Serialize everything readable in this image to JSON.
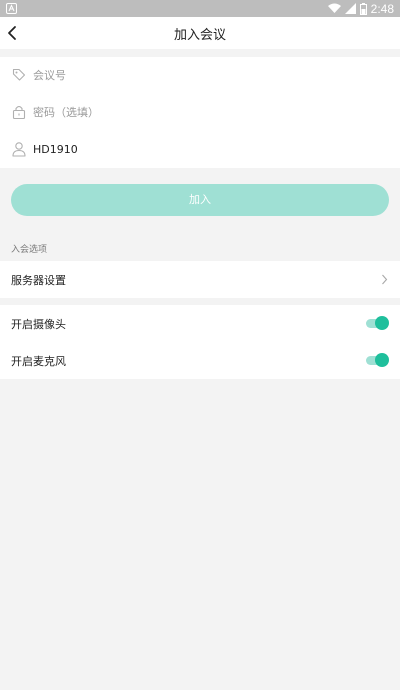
{
  "status_bar": {
    "time": "2:48",
    "notification_icon": "notification-icon",
    "wifi_icon": "wifi-icon",
    "signal_icon": "signal-icon",
    "battery_icon": "battery-icon"
  },
  "header": {
    "title": "加入会议",
    "back_icon": "back-arrow-icon"
  },
  "form": {
    "meeting_id": {
      "value": "",
      "placeholder": "会议号",
      "icon": "tag-icon"
    },
    "password": {
      "value": "",
      "placeholder": "密码（选填）",
      "icon": "lock-icon"
    },
    "name": {
      "value": "HD1910",
      "placeholder": "",
      "icon": "user-icon"
    }
  },
  "join_button": {
    "label": "加入"
  },
  "options": {
    "section_title": "入会选项",
    "server_settings": {
      "label": "服务器设置"
    },
    "camera": {
      "label": "开启摄像头",
      "enabled": true
    },
    "microphone": {
      "label": "开启麦克风",
      "enabled": true
    }
  },
  "colors": {
    "accent": "#1fbf9c",
    "accent_light": "#9fe0d4",
    "background": "#f3f3f3"
  }
}
